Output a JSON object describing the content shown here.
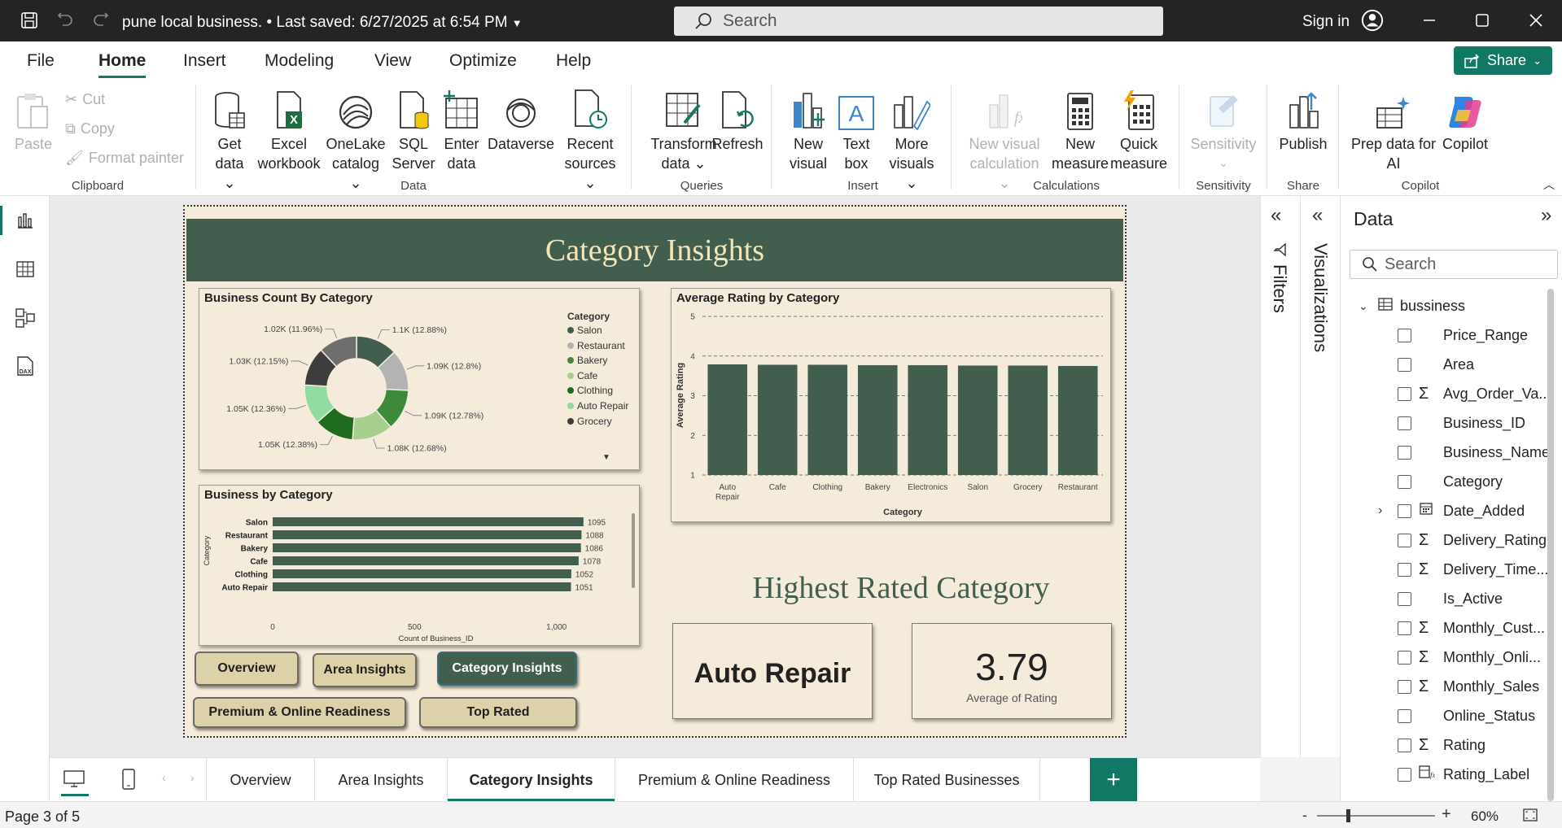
{
  "app": {
    "title": "pune local business. • Last saved: 6/27/2025 at 6:54 PM",
    "search_placeholder": "Search",
    "sign_in": "Sign in"
  },
  "menu": {
    "items": [
      "File",
      "Home",
      "Insert",
      "Modeling",
      "View",
      "Optimize",
      "Help"
    ],
    "active": "Home",
    "share": "Share"
  },
  "ribbon": {
    "clipboard": {
      "paste": "Paste",
      "cut": "Cut",
      "copy": "Copy",
      "format_painter": "Format painter",
      "group": "Clipboard"
    },
    "data": {
      "get_data": [
        "Get",
        "data ⌄"
      ],
      "excel": [
        "Excel",
        "workbook"
      ],
      "onelake": [
        "OneLake",
        "catalog ⌄"
      ],
      "sql": [
        "SQL",
        "Server"
      ],
      "enter": [
        "Enter",
        "data"
      ],
      "dataverse": "Dataverse",
      "recent": [
        "Recent",
        "sources ⌄"
      ],
      "group": "Data"
    },
    "queries": {
      "transform": [
        "Transform",
        "data ⌄"
      ],
      "refresh": "Refresh",
      "group": "Queries"
    },
    "insert": {
      "new_visual": [
        "New",
        "visual"
      ],
      "text_box": [
        "Text",
        "box"
      ],
      "more_visuals": [
        "More",
        "visuals ⌄"
      ],
      "group": "Insert"
    },
    "calculations": {
      "new_visual_calc": [
        "New visual",
        "calculation ⌄"
      ],
      "new_measure": [
        "New",
        "measure"
      ],
      "quick_measure": [
        "Quick",
        "measure"
      ],
      "group": "Calculations"
    },
    "sensitivity": {
      "label": "Sensitivity",
      "group": "Sensitivity"
    },
    "share": {
      "publish": "Publish",
      "group": "Share"
    },
    "copilot": {
      "prep": [
        "Prep data for",
        "AI"
      ],
      "copilot": "Copilot",
      "group": "Copilot"
    }
  },
  "report": {
    "title": "Category Insights",
    "donut_title": "Business Count By Category",
    "bar_title": "Business by Category",
    "col_title": "Average Rating by Category",
    "highest_title": "Highest Rated Category",
    "kpi_category": "Auto Repair",
    "kpi_value": "3.79",
    "kpi_label": "Average of Rating",
    "buttons": [
      "Overview",
      "Area Insights",
      "Category Insights",
      "Premium & Online Readiness",
      "Top Rated"
    ]
  },
  "chart_data": [
    {
      "type": "pie",
      "title": "Business Count By Category",
      "legend_title": "Category",
      "legend_position": "right",
      "legend": [
        "Salon",
        "Restaurant",
        "Bakery",
        "Cafe",
        "Clothing",
        "Auto Repair",
        "Grocery"
      ],
      "slices": [
        {
          "label": "1.1K (12.88%)",
          "value": 1.1,
          "color": "#415e4f"
        },
        {
          "label": "1.09K (12.8%)",
          "value": 1.09,
          "color": "#b3b3b3"
        },
        {
          "label": "1.09K (12.78%)",
          "value": 1.09,
          "color": "#3c8a3a"
        },
        {
          "label": "1.08K (12.68%)",
          "value": 1.08,
          "color": "#a6cf8e"
        },
        {
          "label": "1.05K (12.38%)",
          "value": 1.05,
          "color": "#1f6b1f"
        },
        {
          "label": "1.05K (12.36%)",
          "value": 1.05,
          "color": "#90dba0"
        },
        {
          "label": "1.03K (12.15%)",
          "value": 1.03,
          "color": "#3d3d3d"
        },
        {
          "label": "1.02K (11.96%)",
          "value": 1.02,
          "color": "#6e6e6e"
        }
      ],
      "legend_colors": [
        "#415e4f",
        "#b3b3b3",
        "#3c8a3a",
        "#a6cf8e",
        "#1f6b1f",
        "#90dba0",
        "#3d3d3d"
      ]
    },
    {
      "type": "bar",
      "title": "Business by Category",
      "categories": [
        "Salon",
        "Restaurant",
        "Bakery",
        "Cafe",
        "Clothing",
        "Auto Repair"
      ],
      "values": [
        1095,
        1088,
        1086,
        1078,
        1052,
        1051
      ],
      "xlabel": "Count of Business_ID",
      "ylabel": "Category",
      "xticks": [
        "0",
        "500",
        "1,000"
      ],
      "xlim": [
        0,
        1150
      ],
      "color": "#415e4f"
    },
    {
      "type": "bar",
      "title": "Average Rating by Category",
      "categories": [
        "Auto Repair",
        "Cafe",
        "Clothing",
        "Bakery",
        "Electronics",
        "Salon",
        "Grocery",
        "Restaurant"
      ],
      "values": [
        3.79,
        3.78,
        3.78,
        3.77,
        3.77,
        3.76,
        3.76,
        3.75
      ],
      "xlabel": "Category",
      "ylabel": "Average Rating",
      "yticks": [
        "1",
        "2",
        "3",
        "4",
        "5"
      ],
      "ylim": [
        1,
        5
      ],
      "grid": true,
      "color": "#415e4f"
    }
  ],
  "panes": {
    "filters": "Filters",
    "visualizations": "Visualizations",
    "data": {
      "title": "Data",
      "search_placeholder": "Search",
      "table": "bussiness",
      "fields": [
        {
          "sym": "",
          "name": "Price_Range"
        },
        {
          "sym": "",
          "name": "Area"
        },
        {
          "sym": "Σ",
          "name": "Avg_Order_Va..."
        },
        {
          "sym": "",
          "name": "Business_ID"
        },
        {
          "sym": "",
          "name": "Business_Name"
        },
        {
          "sym": "",
          "name": "Category"
        },
        {
          "sym": "cal",
          "name": "Date_Added"
        },
        {
          "sym": "Σ",
          "name": "Delivery_Rating"
        },
        {
          "sym": "Σ",
          "name": "Delivery_Time..."
        },
        {
          "sym": "",
          "name": "Is_Active"
        },
        {
          "sym": "Σ",
          "name": "Monthly_Cust..."
        },
        {
          "sym": "Σ",
          "name": "Monthly_Onli..."
        },
        {
          "sym": "Σ",
          "name": "Monthly_Sales"
        },
        {
          "sym": "",
          "name": "Online_Status"
        },
        {
          "sym": "Σ",
          "name": "Rating"
        },
        {
          "sym": "fx",
          "name": "Rating_Label"
        }
      ]
    }
  },
  "tabs": [
    "Overview",
    "Area Insights",
    "Category Insights",
    "Premium & Online Readiness",
    "Top Rated Businesses"
  ],
  "active_tab": "Category Insights",
  "status": {
    "page": "Page 3 of 5",
    "zoom": "60%"
  },
  "colors": {
    "accent": "#117865",
    "banner": "#415e4f",
    "report_bg": "#f4ebda",
    "button": "#ddd1a9"
  }
}
